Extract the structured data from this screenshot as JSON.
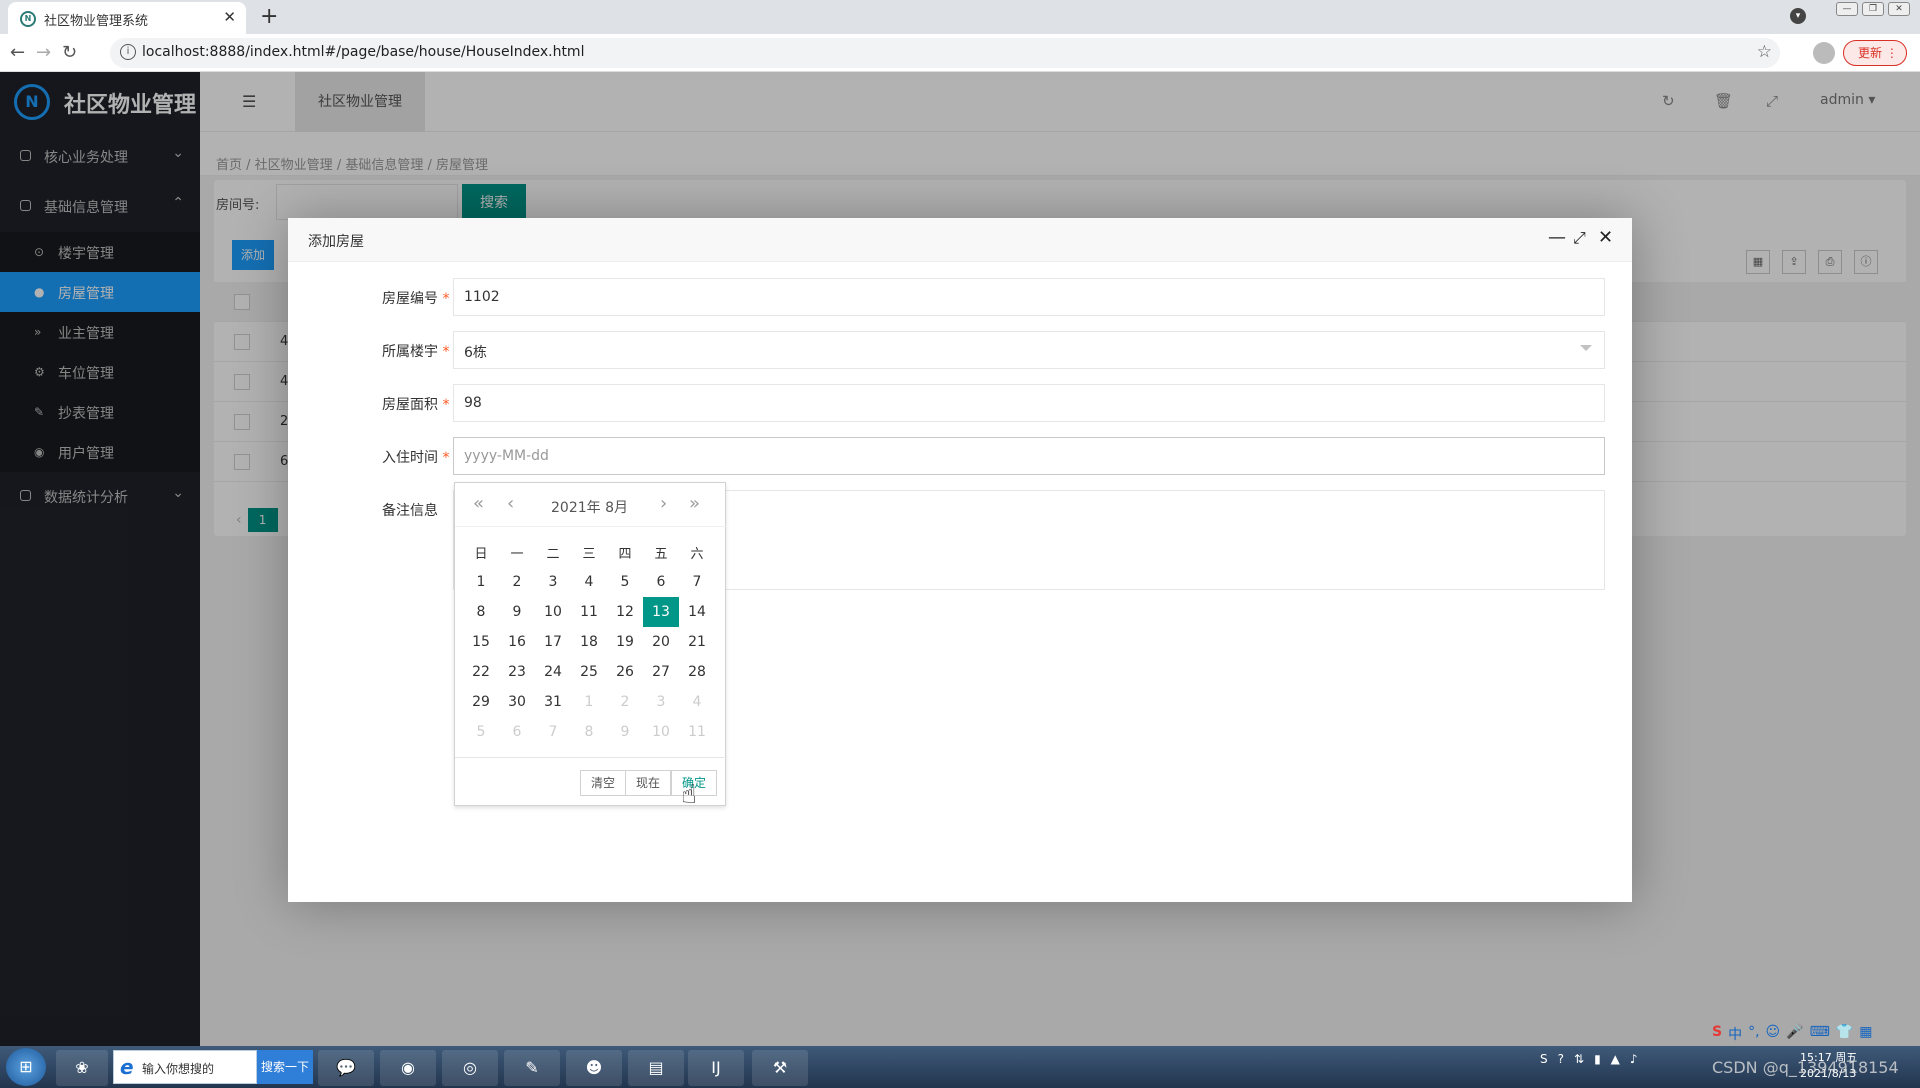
{
  "browser": {
    "tab_title": "社区物业管理系统",
    "url": "localhost:8888/index.html#/page/base/house/HouseIndex.html",
    "update_label": "更新"
  },
  "sidebar": {
    "logo_text": "社区物业管理",
    "groups": [
      {
        "label": "核心业务处理"
      },
      {
        "label": "基础信息管理"
      },
      {
        "label": "数据统计分析"
      }
    ],
    "items": [
      {
        "label": "楼宇管理",
        "icon": "⊙"
      },
      {
        "label": "房屋管理",
        "icon": "●"
      },
      {
        "label": "业主管理",
        "icon": "»"
      },
      {
        "label": "车位管理",
        "icon": "⚙"
      },
      {
        "label": "抄表管理",
        "icon": "✎"
      },
      {
        "label": "用户管理",
        "icon": "◉"
      }
    ]
  },
  "topbar": {
    "tab_label": "社区物业管理",
    "user": "admin"
  },
  "breadcrumb": [
    "首页",
    "社区物业管理",
    "基础信息管理",
    "房屋管理"
  ],
  "search": {
    "label": "房间号:",
    "button": "搜索"
  },
  "toolbar": {
    "add_label": "添加"
  },
  "table": {
    "row_prefixes": [
      "4",
      "4",
      "2",
      "6"
    ]
  },
  "pager": {
    "page": "1"
  },
  "modal": {
    "title": "添加房屋",
    "fields": {
      "house_no": {
        "label": "房屋编号",
        "value": "1102"
      },
      "building": {
        "label": "所属楼宇",
        "value": "6栋"
      },
      "area": {
        "label": "房屋面积",
        "value": "98"
      },
      "checkin": {
        "label": "入住时间",
        "placeholder": "yyyy-MM-dd"
      },
      "remark": {
        "label": "备注信息"
      }
    }
  },
  "datepicker": {
    "year_month": "2021年  8月",
    "weekdays": [
      "日",
      "一",
      "二",
      "三",
      "四",
      "五",
      "六"
    ],
    "selected_day": "13",
    "days": [
      [
        "1",
        "2",
        "3",
        "4",
        "5",
        "6",
        "7"
      ],
      [
        "8",
        "9",
        "10",
        "11",
        "12",
        "13",
        "14"
      ],
      [
        "15",
        "16",
        "17",
        "18",
        "19",
        "20",
        "21"
      ],
      [
        "22",
        "23",
        "24",
        "25",
        "26",
        "27",
        "28"
      ],
      [
        "29",
        "30",
        "31",
        "1",
        "2",
        "3",
        "4"
      ],
      [
        "5",
        "6",
        "7",
        "8",
        "9",
        "10",
        "11"
      ]
    ],
    "clear_label": "清空",
    "now_label": "现在",
    "confirm_label": "确定"
  },
  "taskbar": {
    "search_text": "输入你想搜的",
    "search_button": "搜索一下",
    "time": "15:17 周五",
    "date": "2021/8/13",
    "watermark": "CSDN @q_1394918154"
  },
  "colors": {
    "sidebar_bg": "#20222a",
    "active_blue": "#1e9fff",
    "primary_green": "#009688",
    "required_red": "#ff5722"
  }
}
